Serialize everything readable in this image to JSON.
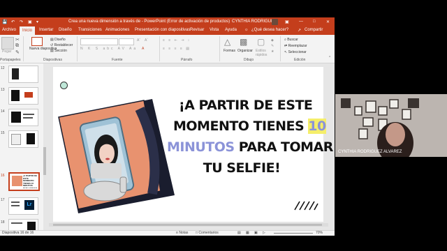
{
  "window": {
    "doc_title": "Crea una nueva dimensión a través de  -  PowerPoint (Error de activación de productos)",
    "user_name": "CYNTHIA RODRIGUEZ"
  },
  "ribbon_tabs": [
    "Archivo",
    "Inicio",
    "Insertar",
    "Diseño",
    "Transiciones",
    "Animaciones",
    "Presentación con diapositivas",
    "Revisar",
    "Vista",
    "Ayuda",
    "¿Qué desea hacer?",
    "Compartir"
  ],
  "ribbon": {
    "pegar": "Pegar",
    "nueva_diapositiva": "Nueva diapositiva",
    "diseno": "Diseño",
    "restablecer": "Restablecer",
    "seccion": "Sección",
    "formas": "Formas",
    "organizar": "Organizar",
    "estilos_rapidos": "Estilos rápidos",
    "buscar": "Buscar",
    "reemplazar": "Reemplazar",
    "seleccionar": "Seleccionar",
    "groups": {
      "portapapeles": "Portapapeles",
      "diapositivas": "Diapositivas",
      "fuente": "Fuente",
      "parrafo": "Párrafo",
      "dibujo": "Dibujo",
      "edicion": "Edición"
    }
  },
  "thumbnails": [
    {
      "num": "12",
      "thumb_text": ""
    },
    {
      "num": "13",
      "thumb_text": ""
    },
    {
      "num": "14",
      "thumb_text": ""
    },
    {
      "num": "15",
      "thumb_text": ""
    },
    {
      "num": "16",
      "thumb_text": "¡A PARTIR DE ESTE MOMENTO TIENES 10 MINUTOS PARA TOMAR TU SELFIE!"
    },
    {
      "num": "17",
      "thumb_text": "Lr"
    },
    {
      "num": "18",
      "thumb_text": ""
    },
    {
      "num": "19",
      "thumb_text": ""
    }
  ],
  "slide": {
    "line1": "¡A PARTIR DE ESTE",
    "line2_a": "MOMENTO TIENES ",
    "line2_b": "10",
    "line3_a": "MINUTOS",
    "line3_b": " PARA TOMAR",
    "line4": "TU SELFIE!"
  },
  "status": {
    "slide_count": "Diapositiva 16 de 16",
    "notas": "Notas",
    "comentarios": "Comentarios",
    "zoom": "70%"
  },
  "participant": {
    "name": "CYNTHIA RODRIGUEZ ALVAREZ"
  },
  "colors": {
    "ppt_accent": "#c43e1c",
    "highlight": "#f5ee6a",
    "minutos_blue": "#8b93d8",
    "illustration_bg": "#e8926f"
  }
}
